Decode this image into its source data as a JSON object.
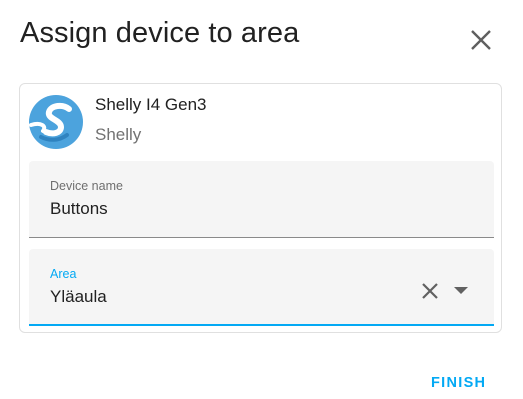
{
  "dialog": {
    "title": "Assign device to area",
    "close_icon": "close-icon"
  },
  "device": {
    "name": "Shelly I4 Gen3",
    "manufacturer": "Shelly",
    "logo_icon": "shelly-logo",
    "brand_color": "#4ca3dd"
  },
  "fields": {
    "device_name": {
      "label": "Device name",
      "value": "Buttons"
    },
    "area": {
      "label": "Area",
      "value": "Yläaula",
      "clear_icon": "clear-icon",
      "dropdown_icon": "dropdown-arrow-icon"
    }
  },
  "actions": {
    "finish_label": "FINISH"
  },
  "colors": {
    "accent": "#03a9f4",
    "text": "#212121",
    "secondary_text": "#727272",
    "field_bg": "#f5f5f5"
  }
}
